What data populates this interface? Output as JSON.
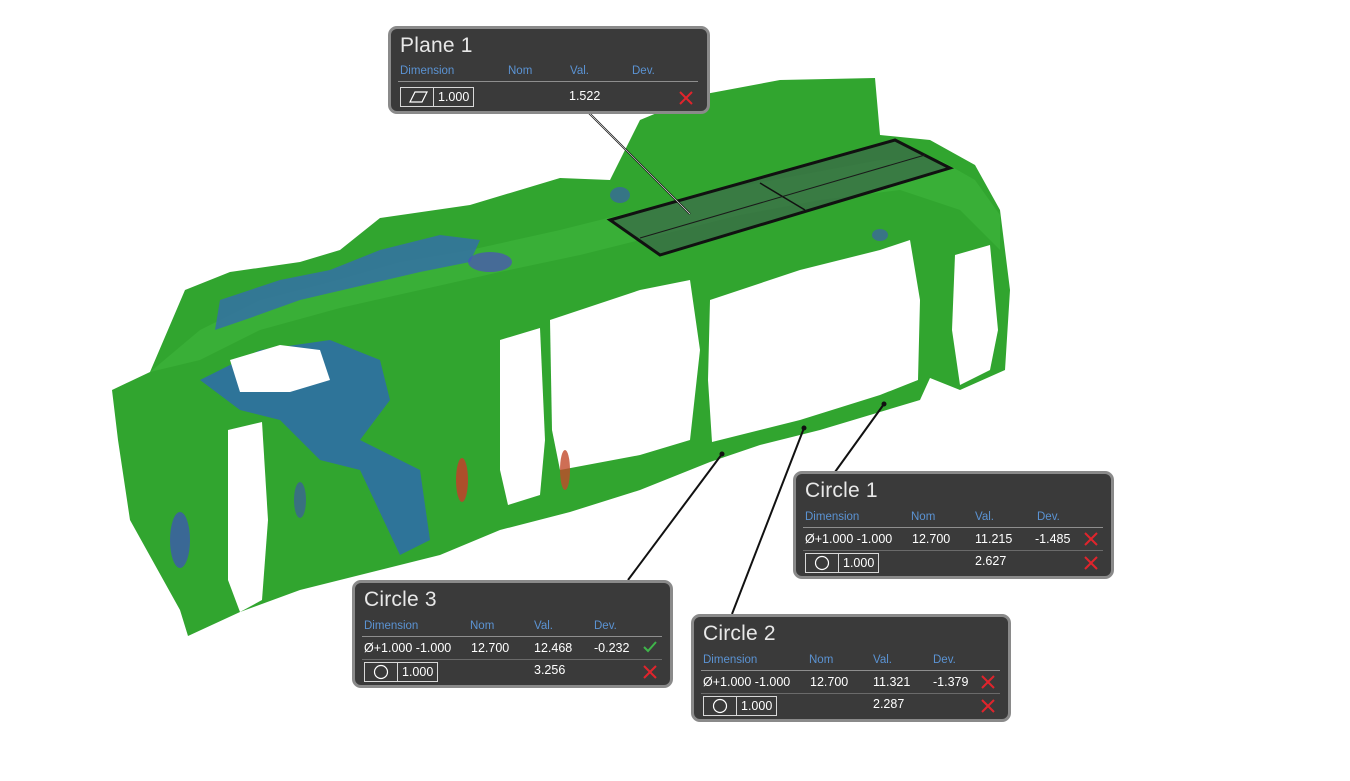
{
  "colors": {
    "panel_bg": "#3a3a3a",
    "header_text": "#5b93d3",
    "fail": "#e0242c",
    "pass": "#3fb54a",
    "surface_green": "#2fa52e"
  },
  "panels": {
    "plane1": {
      "title": "Plane 1",
      "headers": {
        "dimension": "Dimension",
        "nom": "Nom",
        "val": "Val.",
        "dev": "Dev."
      },
      "row1": {
        "icon": "flatness-icon",
        "tolerance": "1.000",
        "val": "1.522",
        "status": "fail"
      }
    },
    "circle1": {
      "title": "Circle 1",
      "headers": {
        "dimension": "Dimension",
        "nom": "Nom",
        "val": "Val.",
        "dev": "Dev."
      },
      "row1": {
        "symbol": "Ø",
        "tolerance": "+1.000 -1.000",
        "nom": "12.700",
        "val": "11.215",
        "dev": "-1.485",
        "status": "fail"
      },
      "row2": {
        "icon": "circularity-icon",
        "tolerance": "1.000",
        "val": "2.627",
        "status": "fail"
      }
    },
    "circle2": {
      "title": "Circle 2",
      "headers": {
        "dimension": "Dimension",
        "nom": "Nom",
        "val": "Val.",
        "dev": "Dev."
      },
      "row1": {
        "symbol": "Ø",
        "tolerance": "+1.000 -1.000",
        "nom": "12.700",
        "val": "11.321",
        "dev": "-1.379",
        "status": "fail"
      },
      "row2": {
        "icon": "circularity-icon",
        "tolerance": "1.000",
        "val": "2.287",
        "status": "fail"
      }
    },
    "circle3": {
      "title": "Circle 3",
      "headers": {
        "dimension": "Dimension",
        "nom": "Nom",
        "val": "Val.",
        "dev": "Dev."
      },
      "row1": {
        "symbol": "Ø",
        "tolerance": "+1.000 -1.000",
        "nom": "12.700",
        "val": "12.468",
        "dev": "-0.232",
        "status": "pass"
      },
      "row2": {
        "icon": "circularity-icon",
        "tolerance": "1.000",
        "val": "3.256",
        "status": "fail"
      }
    }
  }
}
